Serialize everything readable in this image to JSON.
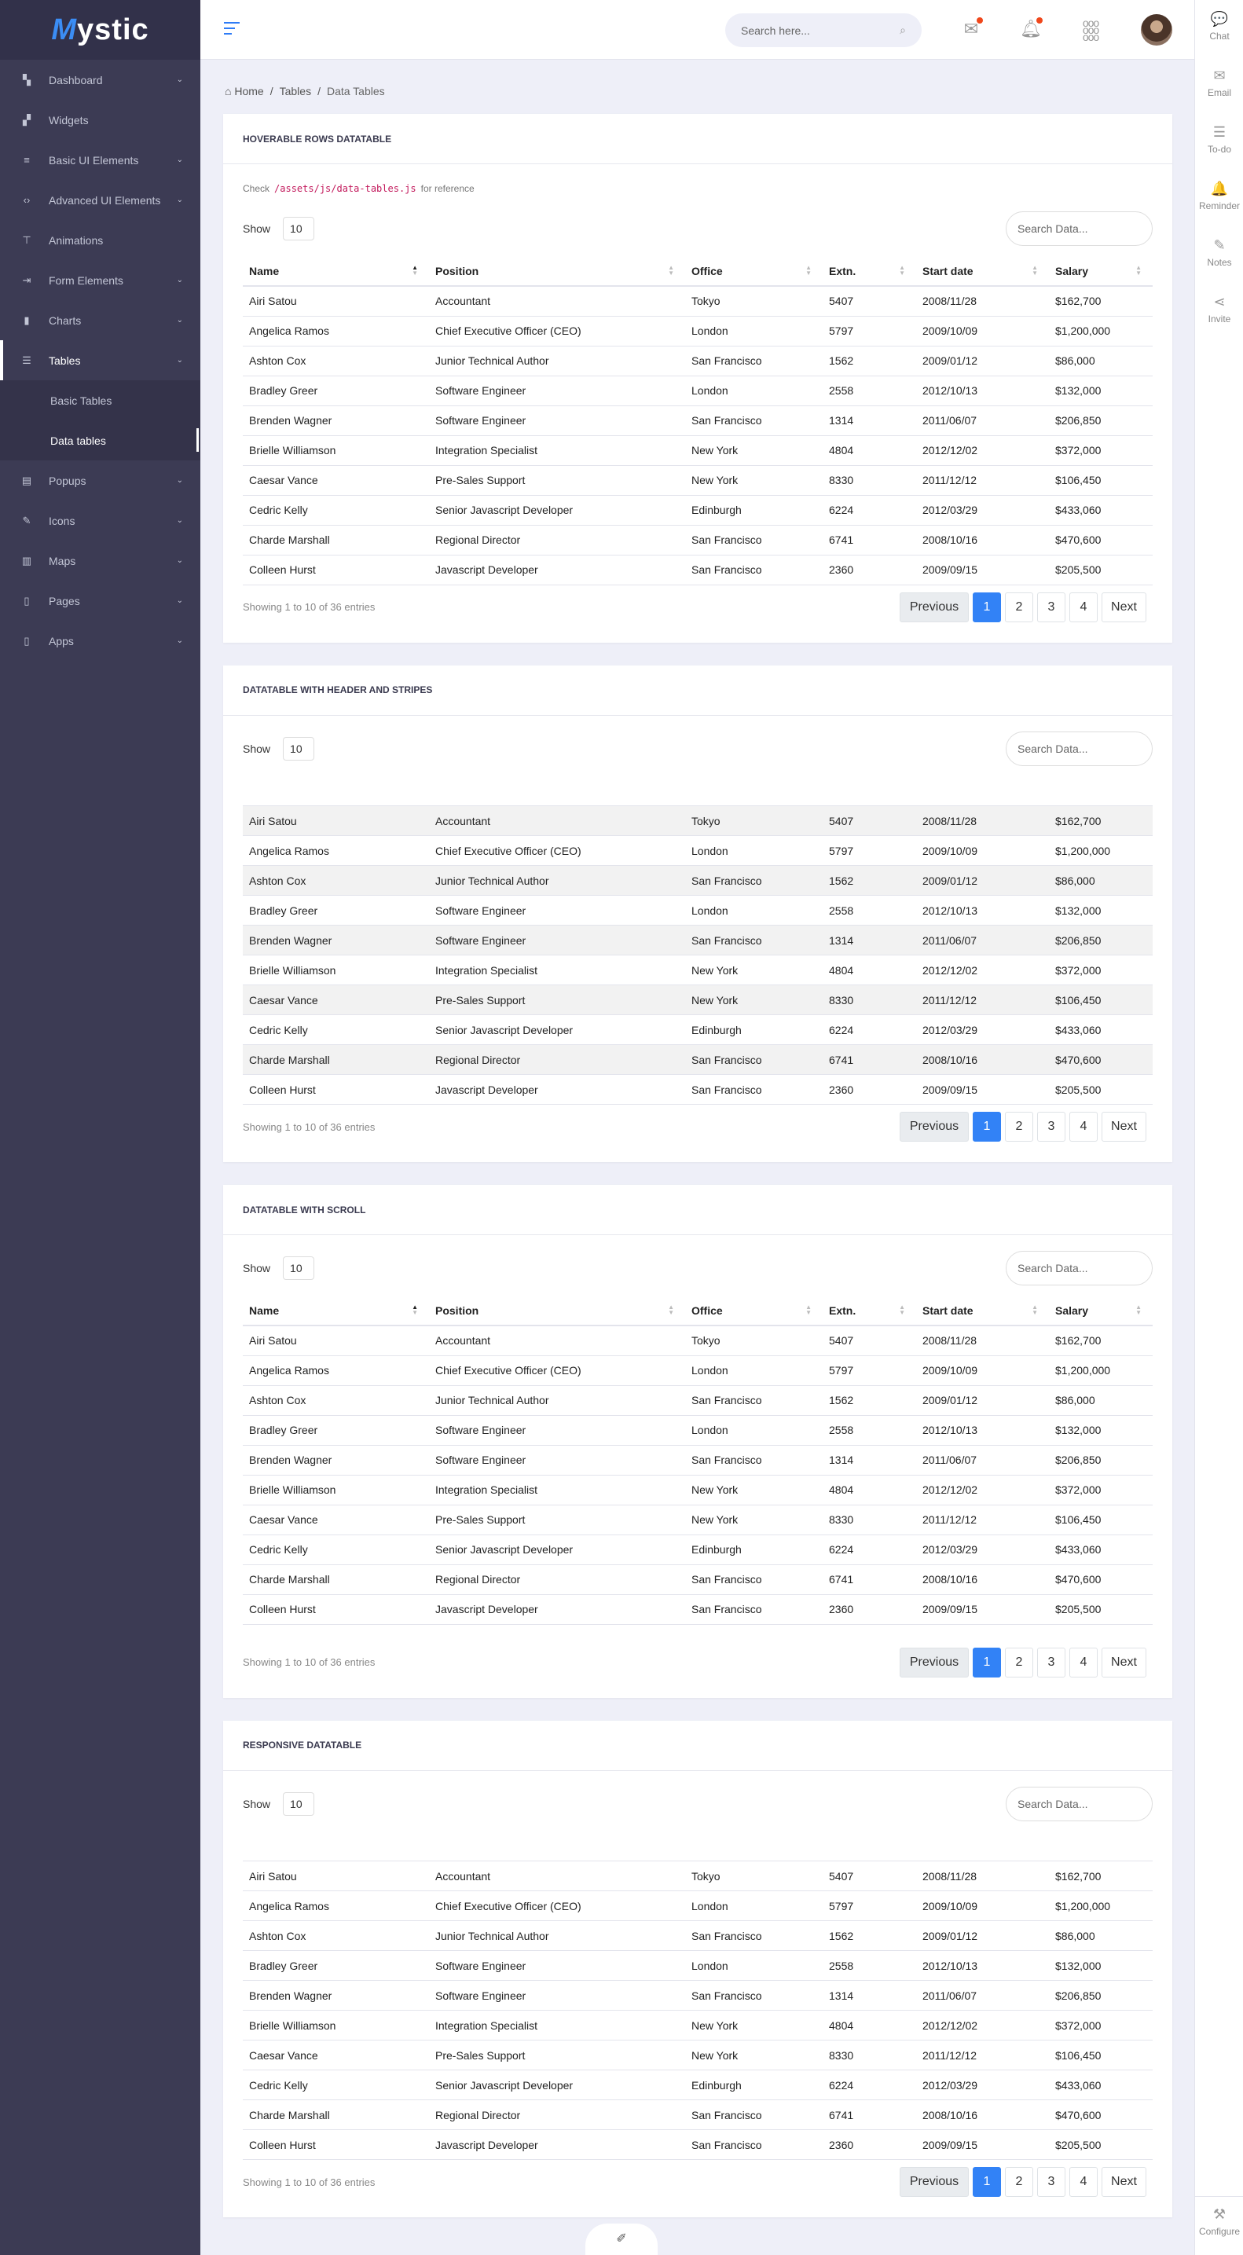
{
  "brand": {
    "name_first": "M",
    "name_rest": "ystic"
  },
  "sidebar": {
    "items": [
      {
        "label": "Dashboard",
        "icon": "▚",
        "name": "dashboard",
        "chev": true
      },
      {
        "label": "Widgets",
        "icon": "▞",
        "name": "widgets",
        "chev": false
      },
      {
        "label": "Basic UI Elements",
        "icon": "≡",
        "name": "basic-ui-elements",
        "chev": true
      },
      {
        "label": "Advanced UI Elements",
        "icon": "‹›",
        "name": "advanced-ui-elements",
        "chev": true
      },
      {
        "label": "Animations",
        "icon": "⊤",
        "name": "animations",
        "chev": false
      },
      {
        "label": "Form Elements",
        "icon": "⇥",
        "name": "form-elements",
        "chev": true
      },
      {
        "label": "Charts",
        "icon": "▮",
        "name": "charts",
        "chev": true
      },
      {
        "label": "Tables",
        "icon": "☰",
        "name": "tables",
        "chev": true,
        "active": true,
        "sub": [
          {
            "label": "Basic Tables"
          },
          {
            "label": "Data tables",
            "active": true
          }
        ]
      },
      {
        "label": "Popups",
        "icon": "▤",
        "name": "popups",
        "chev": true
      },
      {
        "label": "Icons",
        "icon": "✎",
        "name": "icons",
        "chev": true
      },
      {
        "label": "Maps",
        "icon": "▥",
        "name": "maps",
        "chev": true
      },
      {
        "label": "Pages",
        "icon": "▯",
        "name": "pages",
        "chev": true
      },
      {
        "label": "Apps",
        "icon": "▯",
        "name": "apps",
        "chev": true
      }
    ]
  },
  "topbar": {
    "search_placeholder": "Search here..."
  },
  "right_panel": [
    {
      "label": "Chat",
      "icon": "💬"
    },
    {
      "label": "Email",
      "icon": "✉"
    },
    {
      "label": "To-do",
      "icon": "☰"
    },
    {
      "label": "Reminder",
      "icon": "🔔"
    },
    {
      "label": "Notes",
      "icon": "✎"
    },
    {
      "label": "Invite",
      "icon": "⋖"
    }
  ],
  "configure_label": "Configure",
  "breadcrumb": {
    "home": "Home",
    "sep": "/",
    "tables": "Tables",
    "current": "Data Tables"
  },
  "check": {
    "prefix": "Check",
    "path": "/assets/js/data-tables.js",
    "suffix": "for reference"
  },
  "columns": [
    "Name",
    "Position",
    "Office",
    "Extn.",
    "Start date",
    "Salary"
  ],
  "rows": [
    [
      "Airi Satou",
      "Accountant",
      "Tokyo",
      "5407",
      "2008/11/28",
      "$162,700"
    ],
    [
      "Angelica Ramos",
      "Chief Executive Officer (CEO)",
      "London",
      "5797",
      "2009/10/09",
      "$1,200,000"
    ],
    [
      "Ashton Cox",
      "Junior Technical Author",
      "San Francisco",
      "1562",
      "2009/01/12",
      "$86,000"
    ],
    [
      "Bradley Greer",
      "Software Engineer",
      "London",
      "2558",
      "2012/10/13",
      "$132,000"
    ],
    [
      "Brenden Wagner",
      "Software Engineer",
      "San Francisco",
      "1314",
      "2011/06/07",
      "$206,850"
    ],
    [
      "Brielle Williamson",
      "Integration Specialist",
      "New York",
      "4804",
      "2012/12/02",
      "$372,000"
    ],
    [
      "Caesar Vance",
      "Pre-Sales Support",
      "New York",
      "8330",
      "2011/12/12",
      "$106,450"
    ],
    [
      "Cedric Kelly",
      "Senior Javascript Developer",
      "Edinburgh",
      "6224",
      "2012/03/29",
      "$433,060"
    ],
    [
      "Charde Marshall",
      "Regional Director",
      "San Francisco",
      "6741",
      "2008/10/16",
      "$470,600"
    ],
    [
      "Colleen Hurst",
      "Javascript Developer",
      "San Francisco",
      "2360",
      "2009/09/15",
      "$205,500"
    ]
  ],
  "tables": [
    {
      "title": "HOVERABLE ROWS DATATABLE",
      "check": true,
      "header": true,
      "striped": false,
      "scroll": false
    },
    {
      "title": "DATATABLE WITH HEADER AND STRIPES",
      "check": false,
      "header": false,
      "striped": true,
      "scroll": false
    },
    {
      "title": "DATATABLE WITH SCROLL",
      "check": false,
      "header": true,
      "striped": false,
      "scroll": true
    },
    {
      "title": "RESPONSIVE DATATABLE",
      "check": false,
      "header": false,
      "striped": false,
      "scroll": false
    }
  ],
  "controls": {
    "show_label": "Show",
    "show_value": "10",
    "search_placeholder": "Search Data...",
    "info": "Showing 1 to 10 of 36 entries"
  },
  "pagination": {
    "previous": "Previous",
    "pages": [
      "1",
      "2",
      "3",
      "4"
    ],
    "current": "1",
    "next": "Next"
  },
  "colors": {
    "accent": "#3282f6",
    "sidebar": "#3c3b54",
    "notification": "#f0471b"
  }
}
